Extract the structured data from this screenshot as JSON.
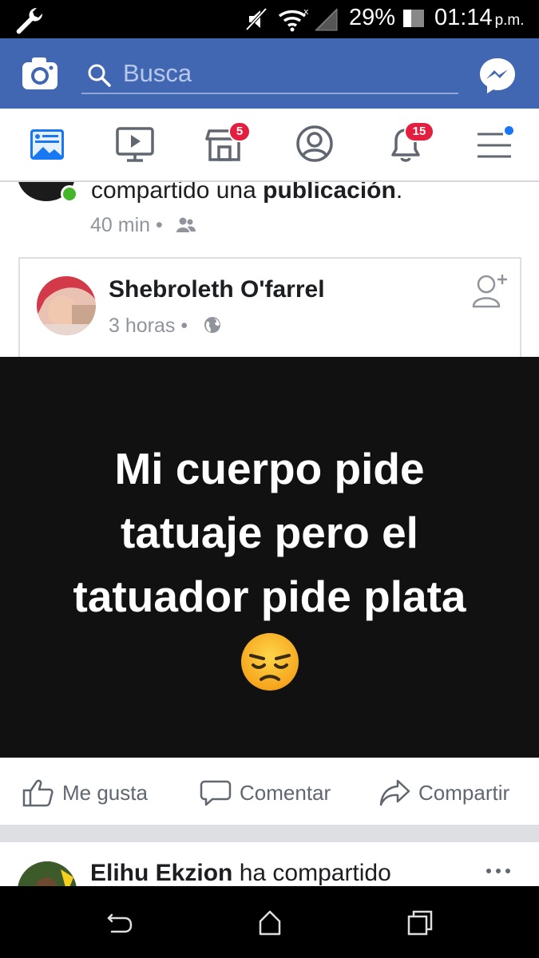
{
  "status_bar": {
    "battery_percent": "29%",
    "time": "01:14",
    "ampm": "p.m."
  },
  "header": {
    "search_placeholder": "Busca",
    "brand_color": "#4267b2"
  },
  "nav": {
    "marketplace_badge": "5",
    "notifications_badge": "15",
    "badge_color": "#e41e3f"
  },
  "feed": {
    "top_post": {
      "text_plain": "compartido una ",
      "text_bold": "publicación",
      "text_end": ".",
      "time": "40 min"
    },
    "shared_post": {
      "author": "Shebroleth O'farrel",
      "time": "3 horas",
      "meme_lines": [
        "Mi cuerpo pide",
        "tatuaje pero el",
        "tatuador pide plata"
      ]
    },
    "actions": {
      "like": "Me gusta",
      "comment": "Comentar",
      "share": "Compartir"
    },
    "next_post": {
      "author": "Elihu Ekzion",
      "text": " ha compartido"
    }
  }
}
